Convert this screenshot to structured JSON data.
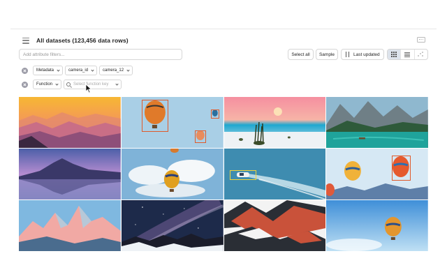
{
  "header": {
    "title": "All datasets (123,456 data rows)"
  },
  "search": {
    "placeholder": "Add attribute filters..."
  },
  "toolbar": {
    "select_all_label": "Select all",
    "sample_label": "Sample",
    "sort_label": "Last updated",
    "views": [
      "grid-view",
      "list-view",
      "scatter-view"
    ],
    "active_view": "grid-view"
  },
  "filters": {
    "row1": {
      "chips": [
        "Metadata",
        "camera_id",
        "camera_12"
      ]
    },
    "row2": {
      "chip": "Function",
      "input_placeholder": "Select function key"
    }
  },
  "gallery": {
    "tiles": [
      {
        "subject": "sunset-mountains"
      },
      {
        "subject": "hot-air-balloons",
        "annotations": 3
      },
      {
        "subject": "desert-moon"
      },
      {
        "subject": "alpine-lake"
      },
      {
        "subject": "purple-mountain-reflection"
      },
      {
        "subject": "balloon-clouds"
      },
      {
        "subject": "speedboat",
        "annotations": 1
      },
      {
        "subject": "balloons-sky",
        "annotations": 1
      },
      {
        "subject": "pink-peaks"
      },
      {
        "subject": "milky-way"
      },
      {
        "subject": "snowy-ridge"
      },
      {
        "subject": "balloon-blue-sky"
      }
    ]
  },
  "colors": {
    "accent_bbox": "#e05a2a",
    "accent_bbox_alt": "#f2d43a",
    "active_view_bg": "#dde3ec"
  }
}
